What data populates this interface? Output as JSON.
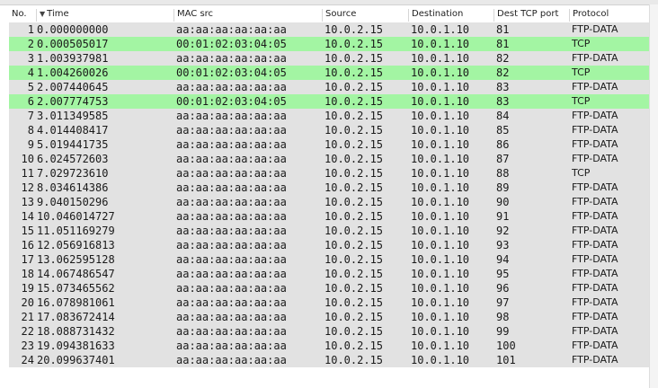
{
  "columns": {
    "no": "No.",
    "time": "Time",
    "mac_src": "MAC src",
    "source": "Source",
    "destination": "Destination",
    "dest_tcp_port": "Dest TCP port",
    "protocol": "Protocol"
  },
  "sorted_column": "time",
  "colors": {
    "default_row": "#e2e2e2",
    "tcp_row": "#a3f5a3"
  },
  "rows": [
    {
      "no": "1",
      "time": "0.000000000",
      "mac": "aa:aa:aa:aa:aa:aa",
      "src": "10.0.2.15",
      "dst": "10.0.1.10",
      "port": "81",
      "proto": "FTP-DATA"
    },
    {
      "no": "2",
      "time": "0.000505017",
      "mac": "00:01:02:03:04:05",
      "src": "10.0.2.15",
      "dst": "10.0.1.10",
      "port": "81",
      "proto": "TCP"
    },
    {
      "no": "3",
      "time": "1.003937981",
      "mac": "aa:aa:aa:aa:aa:aa",
      "src": "10.0.2.15",
      "dst": "10.0.1.10",
      "port": "82",
      "proto": "FTP-DATA"
    },
    {
      "no": "4",
      "time": "1.004260026",
      "mac": "00:01:02:03:04:05",
      "src": "10.0.2.15",
      "dst": "10.0.1.10",
      "port": "82",
      "proto": "TCP"
    },
    {
      "no": "5",
      "time": "2.007440645",
      "mac": "aa:aa:aa:aa:aa:aa",
      "src": "10.0.2.15",
      "dst": "10.0.1.10",
      "port": "83",
      "proto": "FTP-DATA"
    },
    {
      "no": "6",
      "time": "2.007774753",
      "mac": "00:01:02:03:04:05",
      "src": "10.0.2.15",
      "dst": "10.0.1.10",
      "port": "83",
      "proto": "TCP"
    },
    {
      "no": "7",
      "time": "3.011349585",
      "mac": "aa:aa:aa:aa:aa:aa",
      "src": "10.0.2.15",
      "dst": "10.0.1.10",
      "port": "84",
      "proto": "FTP-DATA"
    },
    {
      "no": "8",
      "time": "4.014408417",
      "mac": "aa:aa:aa:aa:aa:aa",
      "src": "10.0.2.15",
      "dst": "10.0.1.10",
      "port": "85",
      "proto": "FTP-DATA"
    },
    {
      "no": "9",
      "time": "5.019441735",
      "mac": "aa:aa:aa:aa:aa:aa",
      "src": "10.0.2.15",
      "dst": "10.0.1.10",
      "port": "86",
      "proto": "FTP-DATA"
    },
    {
      "no": "10",
      "time": "6.024572603",
      "mac": "aa:aa:aa:aa:aa:aa",
      "src": "10.0.2.15",
      "dst": "10.0.1.10",
      "port": "87",
      "proto": "FTP-DATA"
    },
    {
      "no": "11",
      "time": "7.029723610",
      "mac": "aa:aa:aa:aa:aa:aa",
      "src": "10.0.2.15",
      "dst": "10.0.1.10",
      "port": "88",
      "proto": "TCP"
    },
    {
      "no": "12",
      "time": "8.034614386",
      "mac": "aa:aa:aa:aa:aa:aa",
      "src": "10.0.2.15",
      "dst": "10.0.1.10",
      "port": "89",
      "proto": "FTP-DATA"
    },
    {
      "no": "13",
      "time": "9.040150296",
      "mac": "aa:aa:aa:aa:aa:aa",
      "src": "10.0.2.15",
      "dst": "10.0.1.10",
      "port": "90",
      "proto": "FTP-DATA"
    },
    {
      "no": "14",
      "time": "10.046014727",
      "mac": "aa:aa:aa:aa:aa:aa",
      "src": "10.0.2.15",
      "dst": "10.0.1.10",
      "port": "91",
      "proto": "FTP-DATA"
    },
    {
      "no": "15",
      "time": "11.051169279",
      "mac": "aa:aa:aa:aa:aa:aa",
      "src": "10.0.2.15",
      "dst": "10.0.1.10",
      "port": "92",
      "proto": "FTP-DATA"
    },
    {
      "no": "16",
      "time": "12.056916813",
      "mac": "aa:aa:aa:aa:aa:aa",
      "src": "10.0.2.15",
      "dst": "10.0.1.10",
      "port": "93",
      "proto": "FTP-DATA"
    },
    {
      "no": "17",
      "time": "13.062595128",
      "mac": "aa:aa:aa:aa:aa:aa",
      "src": "10.0.2.15",
      "dst": "10.0.1.10",
      "port": "94",
      "proto": "FTP-DATA"
    },
    {
      "no": "18",
      "time": "14.067486547",
      "mac": "aa:aa:aa:aa:aa:aa",
      "src": "10.0.2.15",
      "dst": "10.0.1.10",
      "port": "95",
      "proto": "FTP-DATA"
    },
    {
      "no": "19",
      "time": "15.073465562",
      "mac": "aa:aa:aa:aa:aa:aa",
      "src": "10.0.2.15",
      "dst": "10.0.1.10",
      "port": "96",
      "proto": "FTP-DATA"
    },
    {
      "no": "20",
      "time": "16.078981061",
      "mac": "aa:aa:aa:aa:aa:aa",
      "src": "10.0.2.15",
      "dst": "10.0.1.10",
      "port": "97",
      "proto": "FTP-DATA"
    },
    {
      "no": "21",
      "time": "17.083672414",
      "mac": "aa:aa:aa:aa:aa:aa",
      "src": "10.0.2.15",
      "dst": "10.0.1.10",
      "port": "98",
      "proto": "FTP-DATA"
    },
    {
      "no": "22",
      "time": "18.088731432",
      "mac": "aa:aa:aa:aa:aa:aa",
      "src": "10.0.2.15",
      "dst": "10.0.1.10",
      "port": "99",
      "proto": "FTP-DATA"
    },
    {
      "no": "23",
      "time": "19.094381633",
      "mac": "aa:aa:aa:aa:aa:aa",
      "src": "10.0.2.15",
      "dst": "10.0.1.10",
      "port": "100",
      "proto": "FTP-DATA"
    },
    {
      "no": "24",
      "time": "20.099637401",
      "mac": "aa:aa:aa:aa:aa:aa",
      "src": "10.0.2.15",
      "dst": "10.0.1.10",
      "port": "101",
      "proto": "FTP-DATA"
    }
  ]
}
